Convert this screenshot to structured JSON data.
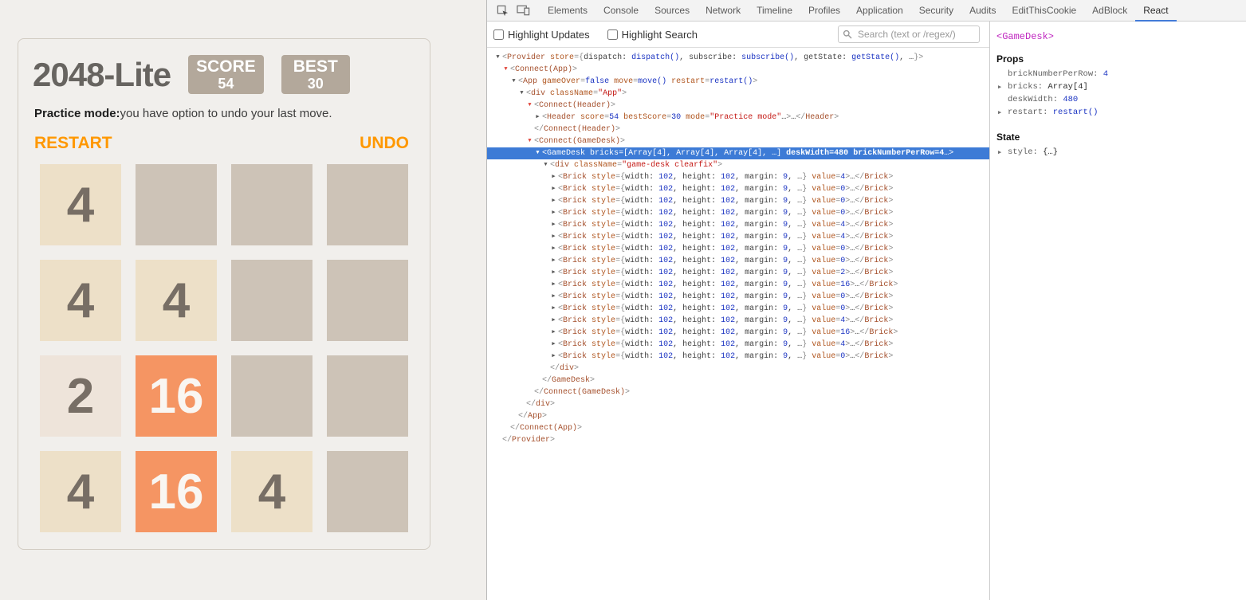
{
  "game": {
    "title": "2048-Lite",
    "score_label": "SCORE",
    "score_value": "54",
    "best_label": "BEST",
    "best_value": "30",
    "mode_bold": "Practice mode:",
    "mode_rest": "you have option to undo your last move.",
    "restart_label": "RESTART",
    "undo_label": "UNDO",
    "grid": [
      [
        4,
        0,
        0,
        0
      ],
      [
        4,
        4,
        0,
        0
      ],
      [
        2,
        16,
        0,
        0
      ],
      [
        4,
        16,
        4,
        0
      ]
    ],
    "colors": {
      "tile_empty": "#cdc3b7",
      "tile_2": "#eee4da",
      "tile_4": "#ede0c8",
      "tile_16": "#f59563",
      "tile_text_dark": "#776e65",
      "tile_text_light": "#f9f6f2",
      "accent_orange": "#ff9800",
      "scorebox_bg": "#b3a89b"
    }
  },
  "devtools": {
    "tabs": [
      "Elements",
      "Console",
      "Sources",
      "Network",
      "Timeline",
      "Profiles",
      "Application",
      "Security",
      "Audits",
      "EditThisCookie",
      "AdBlock",
      "React"
    ],
    "active_tab": "React",
    "toolbar": {
      "highlight_updates": "Highlight Updates",
      "highlight_search": "Highlight Search",
      "search_placeholder": "Search (text or /regex/)"
    },
    "tree": {
      "lines": [
        {
          "indent": 0,
          "arrow": "down",
          "arrowColor": "black",
          "tokens": [
            {
              "c": "p",
              "s": "<"
            },
            {
              "c": "t",
              "s": "Provider"
            },
            {
              "c": "x",
              "s": " "
            },
            {
              "c": "a",
              "s": "store"
            },
            {
              "c": "p",
              "s": "={"
            },
            {
              "c": "x",
              "s": "dispatch: "
            },
            {
              "c": "n",
              "s": "dispatch()"
            },
            {
              "c": "x",
              "s": ", subscribe: "
            },
            {
              "c": "n",
              "s": "subscribe()"
            },
            {
              "c": "x",
              "s": ", getState: "
            },
            {
              "c": "n",
              "s": "getState()"
            },
            {
              "c": "x",
              "s": ", …"
            },
            {
              "c": "p",
              "s": "}>"
            }
          ]
        },
        {
          "indent": 1,
          "arrow": "down",
          "arrowColor": "red",
          "tokens": [
            {
              "c": "p",
              "s": "<"
            },
            {
              "c": "t",
              "s": "Connect(App)"
            },
            {
              "c": "p",
              "s": ">"
            }
          ]
        },
        {
          "indent": 2,
          "arrow": "down",
          "arrowColor": "black",
          "tokens": [
            {
              "c": "p",
              "s": "<"
            },
            {
              "c": "t",
              "s": "App"
            },
            {
              "c": "x",
              "s": " "
            },
            {
              "c": "a",
              "s": "gameOver"
            },
            {
              "c": "p",
              "s": "="
            },
            {
              "c": "n",
              "s": "false"
            },
            {
              "c": "x",
              "s": " "
            },
            {
              "c": "a",
              "s": "move"
            },
            {
              "c": "p",
              "s": "="
            },
            {
              "c": "n",
              "s": "move()"
            },
            {
              "c": "x",
              "s": " "
            },
            {
              "c": "a",
              "s": "restart"
            },
            {
              "c": "p",
              "s": "="
            },
            {
              "c": "n",
              "s": "restart()"
            },
            {
              "c": "p",
              "s": ">"
            }
          ]
        },
        {
          "indent": 3,
          "arrow": "down",
          "arrowColor": "black",
          "tokens": [
            {
              "c": "p",
              "s": "<"
            },
            {
              "c": "t",
              "s": "div"
            },
            {
              "c": "x",
              "s": " "
            },
            {
              "c": "a",
              "s": "className"
            },
            {
              "c": "p",
              "s": "="
            },
            {
              "c": "s",
              "s": "\"App\""
            },
            {
              "c": "p",
              "s": ">"
            }
          ]
        },
        {
          "indent": 4,
          "arrow": "down",
          "arrowColor": "red",
          "tokens": [
            {
              "c": "p",
              "s": "<"
            },
            {
              "c": "t",
              "s": "Connect(Header)"
            },
            {
              "c": "p",
              "s": ">"
            }
          ]
        },
        {
          "indent": 5,
          "arrow": "right",
          "arrowColor": "black",
          "tokens": [
            {
              "c": "p",
              "s": "<"
            },
            {
              "c": "t",
              "s": "Header"
            },
            {
              "c": "x",
              "s": " "
            },
            {
              "c": "a",
              "s": "score"
            },
            {
              "c": "p",
              "s": "="
            },
            {
              "c": "n",
              "s": "54"
            },
            {
              "c": "x",
              "s": " "
            },
            {
              "c": "a",
              "s": "bestScore"
            },
            {
              "c": "p",
              "s": "="
            },
            {
              "c": "n",
              "s": "30"
            },
            {
              "c": "x",
              "s": " "
            },
            {
              "c": "a",
              "s": "mode"
            },
            {
              "c": "p",
              "s": "="
            },
            {
              "c": "s",
              "s": "\"Practice mode\""
            },
            {
              "c": "x",
              "s": "…"
            },
            {
              "c": "p",
              "s": ">"
            },
            {
              "c": "x",
              "s": "…"
            },
            {
              "c": "p",
              "s": "</"
            },
            {
              "c": "t",
              "s": "Header"
            },
            {
              "c": "p",
              "s": ">"
            }
          ]
        },
        {
          "indent": 4,
          "arrow": null,
          "arrowColor": null,
          "tokens": [
            {
              "c": "p",
              "s": "</"
            },
            {
              "c": "t",
              "s": "Connect(Header)"
            },
            {
              "c": "p",
              "s": ">"
            }
          ]
        },
        {
          "indent": 4,
          "arrow": "down",
          "arrowColor": "red",
          "tokens": [
            {
              "c": "p",
              "s": "<"
            },
            {
              "c": "t",
              "s": "Connect(GameDesk)"
            },
            {
              "c": "p",
              "s": ">"
            }
          ]
        },
        {
          "indent": 5,
          "arrow": "down",
          "arrowColor": "black",
          "selected": true,
          "tokens": [
            {
              "c": "p",
              "s": "<"
            },
            {
              "c": "t",
              "s": "GameDesk"
            },
            {
              "c": "x",
              "s": " "
            },
            {
              "c": "a",
              "s": "bricks"
            },
            {
              "c": "p",
              "s": "="
            },
            {
              "c": "x",
              "s": "[Array[4], Array[4], Array[4], …]"
            },
            {
              "c": "x",
              "s": " "
            },
            {
              "c": "a",
              "s": "deskWidth",
              "b": true
            },
            {
              "c": "p",
              "s": "=",
              "b": true
            },
            {
              "c": "n",
              "s": "480",
              "b": true
            },
            {
              "c": "x",
              "s": " "
            },
            {
              "c": "a",
              "s": "brickNumberPerRow",
              "b": true
            },
            {
              "c": "p",
              "s": "=",
              "b": true
            },
            {
              "c": "n",
              "s": "4",
              "b": true
            },
            {
              "c": "x",
              "s": "…"
            },
            {
              "c": "p",
              "s": ">"
            }
          ]
        },
        {
          "indent": 6,
          "arrow": "down",
          "arrowColor": "black",
          "tokens": [
            {
              "c": "p",
              "s": "<"
            },
            {
              "c": "t",
              "s": "div"
            },
            {
              "c": "x",
              "s": " "
            },
            {
              "c": "a",
              "s": "className"
            },
            {
              "c": "p",
              "s": "="
            },
            {
              "c": "s",
              "s": "\"game-desk clearfix\""
            },
            {
              "c": "p",
              "s": ">"
            }
          ]
        },
        {
          "ref": "brick",
          "value": 4
        },
        {
          "ref": "brick",
          "value": 0
        },
        {
          "ref": "brick",
          "value": 0
        },
        {
          "ref": "brick",
          "value": 0
        },
        {
          "ref": "brick",
          "value": 4
        },
        {
          "ref": "brick",
          "value": 4
        },
        {
          "ref": "brick",
          "value": 0
        },
        {
          "ref": "brick",
          "value": 0
        },
        {
          "ref": "brick",
          "value": 2
        },
        {
          "ref": "brick",
          "value": 16
        },
        {
          "ref": "brick",
          "value": 0
        },
        {
          "ref": "brick",
          "value": 0
        },
        {
          "ref": "brick",
          "value": 4
        },
        {
          "ref": "brick",
          "value": 16
        },
        {
          "ref": "brick",
          "value": 4
        },
        {
          "ref": "brick",
          "value": 0
        },
        {
          "indent": 6,
          "arrow": null,
          "tokens": [
            {
              "c": "p",
              "s": "</"
            },
            {
              "c": "t",
              "s": "div"
            },
            {
              "c": "p",
              "s": ">"
            }
          ]
        },
        {
          "indent": 5,
          "arrow": null,
          "tokens": [
            {
              "c": "p",
              "s": "</"
            },
            {
              "c": "t",
              "s": "GameDesk"
            },
            {
              "c": "p",
              "s": ">"
            }
          ]
        },
        {
          "indent": 4,
          "arrow": null,
          "tokens": [
            {
              "c": "p",
              "s": "</"
            },
            {
              "c": "t",
              "s": "Connect(GameDesk)"
            },
            {
              "c": "p",
              "s": ">"
            }
          ]
        },
        {
          "indent": 3,
          "arrow": null,
          "tokens": [
            {
              "c": "p",
              "s": "</"
            },
            {
              "c": "t",
              "s": "div"
            },
            {
              "c": "p",
              "s": ">"
            }
          ]
        },
        {
          "indent": 2,
          "arrow": null,
          "tokens": [
            {
              "c": "p",
              "s": "</"
            },
            {
              "c": "t",
              "s": "App"
            },
            {
              "c": "p",
              "s": ">"
            }
          ]
        },
        {
          "indent": 1,
          "arrow": null,
          "tokens": [
            {
              "c": "p",
              "s": "</"
            },
            {
              "c": "t",
              "s": "Connect(App)"
            },
            {
              "c": "p",
              "s": ">"
            }
          ]
        },
        {
          "indent": 0,
          "arrow": null,
          "tokens": [
            {
              "c": "p",
              "s": "</"
            },
            {
              "c": "t",
              "s": "Provider"
            },
            {
              "c": "p",
              "s": ">"
            }
          ]
        }
      ],
      "brick_template": {
        "indent": 7,
        "arrow": "right",
        "arrowColor": "black",
        "tokens": [
          {
            "c": "p",
            "s": "<"
          },
          {
            "c": "t",
            "s": "Brick"
          },
          {
            "c": "x",
            "s": " "
          },
          {
            "c": "a",
            "s": "style"
          },
          {
            "c": "p",
            "s": "={"
          },
          {
            "c": "x",
            "s": "width: "
          },
          {
            "c": "n",
            "s": "102"
          },
          {
            "c": "x",
            "s": ", height: "
          },
          {
            "c": "n",
            "s": "102"
          },
          {
            "c": "x",
            "s": ", margin: "
          },
          {
            "c": "n",
            "s": "9"
          },
          {
            "c": "x",
            "s": ", …"
          },
          {
            "c": "p",
            "s": "}"
          },
          {
            "c": "x",
            "s": " "
          },
          {
            "c": "a",
            "s": "value"
          },
          {
            "c": "p",
            "s": "="
          },
          {
            "c": "n",
            "s": "{value}"
          },
          {
            "c": "p",
            "s": ">"
          },
          {
            "c": "x",
            "s": "…"
          },
          {
            "c": "p",
            "s": "</"
          },
          {
            "c": "t",
            "s": "Brick"
          },
          {
            "c": "p",
            "s": ">"
          }
        ]
      }
    },
    "sidebar": {
      "component": "<GameDesk>",
      "props_header": "Props",
      "props": [
        {
          "arrow": false,
          "name": "brickNumberPerRow",
          "value": "4",
          "vtype": "num"
        },
        {
          "arrow": true,
          "name": "bricks",
          "value": "Array[4]",
          "vtype": "obj"
        },
        {
          "arrow": false,
          "name": "deskWidth",
          "value": "480",
          "vtype": "num"
        },
        {
          "arrow": true,
          "name": "restart",
          "value": "restart()",
          "vtype": "fn"
        }
      ],
      "state_header": "State",
      "state": [
        {
          "arrow": true,
          "name": "style",
          "value": "{…}",
          "vtype": "obj"
        }
      ]
    }
  }
}
